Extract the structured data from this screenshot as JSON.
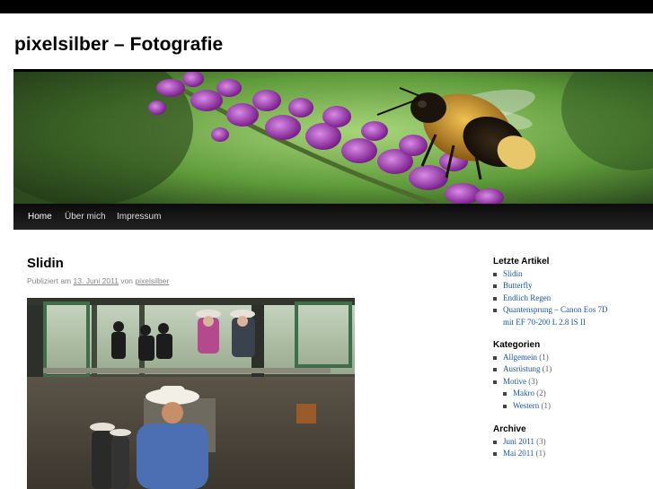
{
  "site": {
    "title": "pixelsilber – Fotografie"
  },
  "nav": [
    "Home",
    "Über mich",
    "Impressum"
  ],
  "post": {
    "title": "Slidin",
    "meta_prefix": "Publiziert am",
    "date": "13. Juni 2011",
    "meta_by": "von",
    "author": "pixelsilber"
  },
  "sidebar": {
    "recent": {
      "title": "Letzte Artikel",
      "items": [
        "Slidin",
        "Butterfly",
        "Endlich Regen",
        "Quantensprung – Canon Eos 7D",
        "mit EF 70-200 L 2.8 IS II"
      ]
    },
    "categories": {
      "title": "Kategorien",
      "items": [
        {
          "name": "Allgemein",
          "count": "(1)"
        },
        {
          "name": "Ausrüstung",
          "count": "(1)"
        },
        {
          "name": "Motive",
          "count": "(3)"
        },
        {
          "name": "Makro",
          "count": "(2)"
        },
        {
          "name": "Western",
          "count": "(1)"
        }
      ]
    },
    "archive": {
      "title": "Archive",
      "items": [
        {
          "name": "Juni 2011",
          "count": "(3)"
        },
        {
          "name": "Mai 2011",
          "count": "(1)"
        }
      ]
    }
  },
  "colors": {
    "link": "#1b57b1",
    "nav_bg": "#111111",
    "text": "#333333"
  }
}
